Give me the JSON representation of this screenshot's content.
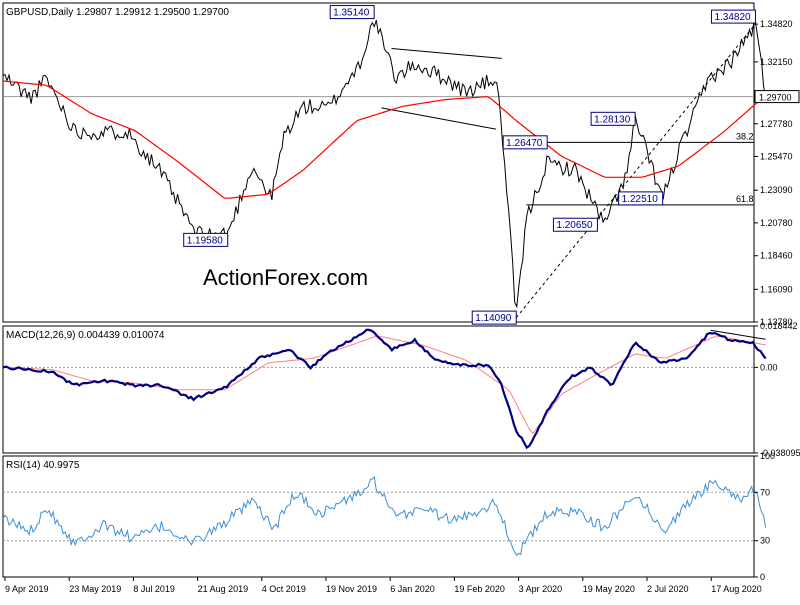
{
  "chart_data": {
    "type": "line",
    "colors": {
      "price": "#000000",
      "ma": "#ff0000",
      "macd": "#000080",
      "signal": "#ff8080",
      "rsi": "#3a8fd8",
      "box": "#000080",
      "grid": "#999999",
      "watermark": "#c8c8c8"
    },
    "watermark": "ActionForex.com",
    "x_labels": [
      "9 Apr 2019",
      "23 May 2019",
      "8 Jul 2019",
      "21 Aug 2019",
      "4 Oct 2019",
      "19 Nov 2019",
      "6 Jan 2020",
      "19 Feb 2020",
      "3 Apr 2020",
      "19 May 2020",
      "2 Jul 2020",
      "17 Aug 2020"
    ],
    "x_range": [
      "2019-04-01",
      "2020-08-31"
    ],
    "price": {
      "header": "GBPUSD,Daily   1.29807  1.29912  1.29500  1.29700",
      "ylim": [
        1.1378,
        1.3631
      ],
      "ticks": [
        {
          "value": 1.3482,
          "label": "1.34820"
        },
        {
          "value": 1.3215,
          "label": "1.32150"
        },
        {
          "value": 1.2778,
          "label": "1.27780"
        },
        {
          "value": 1.2547,
          "label": "1.25470"
        },
        {
          "value": 1.2309,
          "label": "1.23090"
        },
        {
          "value": 1.2078,
          "label": "1.20780"
        },
        {
          "value": 1.1846,
          "label": "1.18460"
        },
        {
          "value": 1.1609,
          "label": "1.16090"
        },
        {
          "value": 1.1378,
          "label": "1.13780"
        }
      ],
      "current": {
        "value": 1.297,
        "label": "1.29700"
      },
      "close": [
        {
          "d": "2019-04-01",
          "v": 1.312
        },
        {
          "d": "2019-04-20",
          "v": 1.296
        },
        {
          "d": "2019-05-01",
          "v": 1.31
        },
        {
          "d": "2019-05-20",
          "v": 1.273
        },
        {
          "d": "2019-06-08",
          "v": 1.271
        },
        {
          "d": "2019-06-25",
          "v": 1.273
        },
        {
          "d": "2019-07-18",
          "v": 1.245
        },
        {
          "d": "2019-08-12",
          "v": 1.2
        },
        {
          "d": "2019-09-03",
          "v": 1.2
        },
        {
          "d": "2019-09-20",
          "v": 1.248
        },
        {
          "d": "2019-10-03",
          "v": 1.225
        },
        {
          "d": "2019-10-12",
          "v": 1.27
        },
        {
          "d": "2019-10-25",
          "v": 1.29
        },
        {
          "d": "2019-11-12",
          "v": 1.289
        },
        {
          "d": "2019-12-03",
          "v": 1.32
        },
        {
          "d": "2019-12-13",
          "v": 1.3514
        },
        {
          "d": "2019-12-28",
          "v": 1.31
        },
        {
          "d": "2020-01-10",
          "v": 1.32
        },
        {
          "d": "2020-01-31",
          "v": 1.31
        },
        {
          "d": "2020-02-14",
          "v": 1.3
        },
        {
          "d": "2020-03-06",
          "v": 1.31
        },
        {
          "d": "2020-03-10",
          "v": 1.275
        },
        {
          "d": "2020-03-15",
          "v": 1.21
        },
        {
          "d": "2020-03-20",
          "v": 1.1409
        },
        {
          "d": "2020-03-27",
          "v": 1.21
        },
        {
          "d": "2020-04-10",
          "v": 1.25
        },
        {
          "d": "2020-04-30",
          "v": 1.245
        },
        {
          "d": "2020-05-20",
          "v": 1.2065
        },
        {
          "d": "2020-06-05",
          "v": 1.245
        },
        {
          "d": "2020-06-10",
          "v": 1.2813
        },
        {
          "d": "2020-06-29",
          "v": 1.2251
        },
        {
          "d": "2020-07-10",
          "v": 1.258
        },
        {
          "d": "2020-07-31",
          "v": 1.31
        },
        {
          "d": "2020-08-14",
          "v": 1.32
        },
        {
          "d": "2020-09-01",
          "v": 1.3482
        },
        {
          "d": "2020-09-08",
          "v": 1.297
        }
      ],
      "ma": [
        {
          "d": "2019-04-01",
          "v": 1.308
        },
        {
          "d": "2019-05-01",
          "v": 1.305
        },
        {
          "d": "2019-06-01",
          "v": 1.285
        },
        {
          "d": "2019-07-01",
          "v": 1.273
        },
        {
          "d": "2019-08-01",
          "v": 1.25
        },
        {
          "d": "2019-09-01",
          "v": 1.225
        },
        {
          "d": "2019-10-01",
          "v": 1.228
        },
        {
          "d": "2019-10-25",
          "v": 1.245
        },
        {
          "d": "2019-12-01",
          "v": 1.28
        },
        {
          "d": "2020-01-01",
          "v": 1.29
        },
        {
          "d": "2020-02-01",
          "v": 1.295
        },
        {
          "d": "2020-03-01",
          "v": 1.297
        },
        {
          "d": "2020-03-20",
          "v": 1.28
        },
        {
          "d": "2020-04-20",
          "v": 1.255
        },
        {
          "d": "2020-05-20",
          "v": 1.24
        },
        {
          "d": "2020-06-15",
          "v": 1.24
        },
        {
          "d": "2020-07-10",
          "v": 1.248
        },
        {
          "d": "2020-08-10",
          "v": 1.272
        },
        {
          "d": "2020-09-08",
          "v": 1.298
        }
      ],
      "callouts": [
        {
          "label": "1.35140",
          "d": "2019-12-13",
          "v": 1.3514,
          "anchor": "left"
        },
        {
          "label": "1.19580",
          "d": "2019-09-03",
          "v": 1.1958,
          "anchor": "left"
        },
        {
          "label": "1.14090",
          "d": "2020-03-20",
          "v": 1.1409,
          "anchor": "left"
        },
        {
          "label": "1.26470",
          "d": "2020-03-11",
          "v": 1.2647,
          "anchor": "right"
        },
        {
          "label": "1.28130",
          "d": "2020-06-10",
          "v": 1.2813,
          "anchor": "left"
        },
        {
          "label": "1.20650",
          "d": "2020-05-15",
          "v": 1.2065,
          "anchor": "left"
        },
        {
          "label": "1.22510",
          "d": "2020-06-29",
          "v": 1.2251,
          "anchor": "left"
        },
        {
          "label": "1.34820",
          "d": "2020-09-01",
          "v": 1.3482,
          "anchor": "left"
        }
      ],
      "fib_levels": [
        {
          "label": "38.2",
          "value": 1.2647,
          "from": "2020-03-11"
        },
        {
          "label": "61.8",
          "value": 1.2205,
          "from": "2020-03-27"
        }
      ],
      "trendlines": [
        {
          "from": [
            "2020-03-20",
            1.1409
          ],
          "to": [
            "2020-09-01",
            1.3482
          ],
          "dashed": true
        },
        {
          "from": [
            "2019-12-25",
            1.331
          ],
          "to": [
            "2020-03-10",
            1.324
          ],
          "dashed": false
        },
        {
          "from": [
            "2019-12-18",
            1.289
          ],
          "to": [
            "2020-03-06",
            1.274
          ],
          "dashed": false
        }
      ]
    },
    "macd": {
      "header": "MACD(12,26,9)  0.004439  0.010074",
      "ylim": [
        -0.0381,
        0.0184
      ],
      "ticks": [
        {
          "value": 0.01844,
          "label": "0.018442"
        },
        {
          "value": 0.0,
          "label": "0.00"
        },
        {
          "value": -0.0381,
          "label": "-0.038095"
        }
      ],
      "macd": [
        {
          "d": "2019-04-01",
          "v": 0.0
        },
        {
          "d": "2019-04-20",
          "v": -0.001
        },
        {
          "d": "2019-05-05",
          "v": -0.002
        },
        {
          "d": "2019-05-20",
          "v": -0.008
        },
        {
          "d": "2019-06-10",
          "v": -0.006
        },
        {
          "d": "2019-07-01",
          "v": -0.008
        },
        {
          "d": "2019-07-20",
          "v": -0.008
        },
        {
          "d": "2019-08-10",
          "v": -0.014
        },
        {
          "d": "2019-09-01",
          "v": -0.009
        },
        {
          "d": "2019-09-25",
          "v": 0.004
        },
        {
          "d": "2019-10-15",
          "v": 0.008
        },
        {
          "d": "2019-10-30",
          "v": 0.0
        },
        {
          "d": "2019-11-15",
          "v": 0.008
        },
        {
          "d": "2019-12-10",
          "v": 0.017
        },
        {
          "d": "2019-12-25",
          "v": 0.008
        },
        {
          "d": "2020-01-10",
          "v": 0.012
        },
        {
          "d": "2020-01-25",
          "v": 0.003
        },
        {
          "d": "2020-02-10",
          "v": 0.001
        },
        {
          "d": "2020-03-01",
          "v": 0.001
        },
        {
          "d": "2020-03-10",
          "v": -0.008
        },
        {
          "d": "2020-03-20",
          "v": -0.028
        },
        {
          "d": "2020-03-28",
          "v": -0.036
        },
        {
          "d": "2020-04-10",
          "v": -0.02
        },
        {
          "d": "2020-04-25",
          "v": -0.005
        },
        {
          "d": "2020-05-10",
          "v": 0.0
        },
        {
          "d": "2020-05-25",
          "v": -0.008
        },
        {
          "d": "2020-06-10",
          "v": 0.011
        },
        {
          "d": "2020-06-28",
          "v": 0.002
        },
        {
          "d": "2020-07-15",
          "v": 0.004
        },
        {
          "d": "2020-08-01",
          "v": 0.016
        },
        {
          "d": "2020-08-15",
          "v": 0.012
        },
        {
          "d": "2020-08-30",
          "v": 0.011
        },
        {
          "d": "2020-09-08",
          "v": 0.004
        }
      ],
      "signal": [
        {
          "d": "2019-04-01",
          "v": 0.0
        },
        {
          "d": "2019-05-05",
          "v": -0.001
        },
        {
          "d": "2019-06-01",
          "v": -0.006
        },
        {
          "d": "2019-07-01",
          "v": -0.007
        },
        {
          "d": "2019-08-01",
          "v": -0.01
        },
        {
          "d": "2019-09-01",
          "v": -0.01
        },
        {
          "d": "2019-10-01",
          "v": 0.002
        },
        {
          "d": "2019-11-01",
          "v": 0.004
        },
        {
          "d": "2019-12-15",
          "v": 0.014
        },
        {
          "d": "2020-01-15",
          "v": 0.01
        },
        {
          "d": "2020-02-15",
          "v": 0.003
        },
        {
          "d": "2020-03-15",
          "v": -0.01
        },
        {
          "d": "2020-03-31",
          "v": -0.03
        },
        {
          "d": "2020-04-20",
          "v": -0.012
        },
        {
          "d": "2020-05-15",
          "v": -0.003
        },
        {
          "d": "2020-06-10",
          "v": 0.006
        },
        {
          "d": "2020-07-01",
          "v": 0.004
        },
        {
          "d": "2020-08-05",
          "v": 0.014
        },
        {
          "d": "2020-09-08",
          "v": 0.01
        }
      ],
      "divergence_line": {
        "from": [
          "2020-08-01",
          0.0165
        ],
        "to": [
          "2020-09-08",
          0.0125
        ]
      }
    },
    "rsi": {
      "header": "RSI(14)  40.9975",
      "ylim": [
        0,
        100
      ],
      "ticks": [
        {
          "value": 100,
          "label": "100"
        },
        {
          "value": 70,
          "label": "70"
        },
        {
          "value": 30,
          "label": "30"
        },
        {
          "value": 0,
          "label": "0"
        }
      ],
      "values": [
        {
          "d": "2019-04-01",
          "v": 48
        },
        {
          "d": "2019-04-20",
          "v": 38
        },
        {
          "d": "2019-05-01",
          "v": 58
        },
        {
          "d": "2019-05-20",
          "v": 28
        },
        {
          "d": "2019-06-10",
          "v": 43
        },
        {
          "d": "2019-06-30",
          "v": 32
        },
        {
          "d": "2019-07-20",
          "v": 42
        },
        {
          "d": "2019-08-10",
          "v": 28
        },
        {
          "d": "2019-09-01",
          "v": 45
        },
        {
          "d": "2019-09-20",
          "v": 62
        },
        {
          "d": "2019-10-05",
          "v": 40
        },
        {
          "d": "2019-10-20",
          "v": 70
        },
        {
          "d": "2019-11-05",
          "v": 52
        },
        {
          "d": "2019-12-01",
          "v": 68
        },
        {
          "d": "2019-12-13",
          "v": 79
        },
        {
          "d": "2019-12-28",
          "v": 48
        },
        {
          "d": "2020-01-15",
          "v": 58
        },
        {
          "d": "2020-02-05",
          "v": 46
        },
        {
          "d": "2020-02-25",
          "v": 56
        },
        {
          "d": "2020-03-06",
          "v": 62
        },
        {
          "d": "2020-03-20",
          "v": 18
        },
        {
          "d": "2020-04-10",
          "v": 52
        },
        {
          "d": "2020-05-01",
          "v": 55
        },
        {
          "d": "2020-05-20",
          "v": 40
        },
        {
          "d": "2020-06-10",
          "v": 70
        },
        {
          "d": "2020-06-29",
          "v": 38
        },
        {
          "d": "2020-07-20",
          "v": 65
        },
        {
          "d": "2020-08-05",
          "v": 80
        },
        {
          "d": "2020-08-20",
          "v": 65
        },
        {
          "d": "2020-09-01",
          "v": 72
        },
        {
          "d": "2020-09-08",
          "v": 41
        }
      ]
    }
  }
}
